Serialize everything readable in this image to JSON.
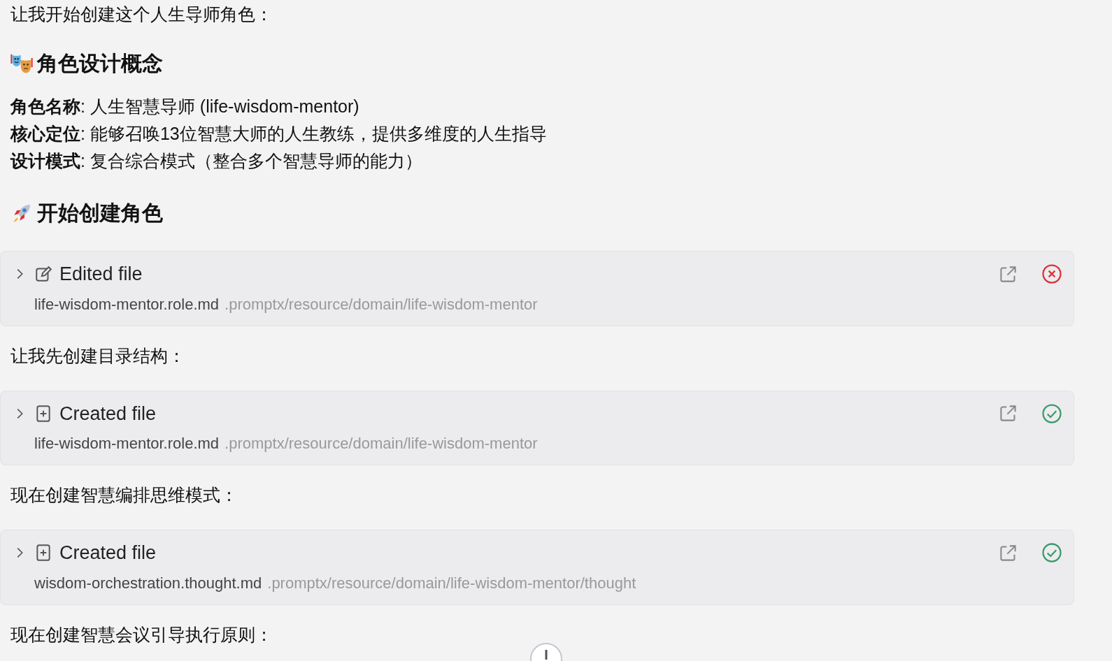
{
  "blocks": [
    {
      "kind": "text",
      "text": "让我开始创建这个人生导师角色："
    },
    {
      "kind": "heading",
      "text": "角色设计概念"
    },
    {
      "kind": "lines",
      "lines": [
        "**角色名称**: 人生智慧导师 (life-wisdom-mentor)",
        "**核心定位**: 能够召唤13位智慧大师的人生教练，提供多维度的人生指导",
        "**设计模式**: 复合综合模式（整合多个智慧导师的能力）"
      ]
    },
    {
      "kind": "heading",
      "text": "开始创建角色"
    },
    {
      "kind": "edited_file",
      "title": "Edited file",
      "filename": "life-wisdom-mentor.role.md",
      "path": ".promptx/resource/domain/life-wisdom-mentor",
      "failed": true,
      "expanded": false
    },
    {
      "kind": "text",
      "text": "让我先创建目录结构："
    },
    {
      "kind": "created_file",
      "title": "Created file",
      "filename": "life-wisdom-mentor.role.md",
      "path": ".promptx/resource/domain/life-wisdom-mentor",
      "failed": false,
      "expanded": false
    },
    {
      "kind": "text",
      "text": "现在创建智慧编排思维模式："
    },
    {
      "kind": "created_file",
      "title": "Created file",
      "filename": "wisdom-orchestration.thought.md",
      "path": ".promptx/resource/domain/life-wisdom-mentor/thought",
      "failed": false,
      "expanded": false
    },
    {
      "kind": "text",
      "text": "现在创建智慧会议引导执行原则："
    }
  ]
}
